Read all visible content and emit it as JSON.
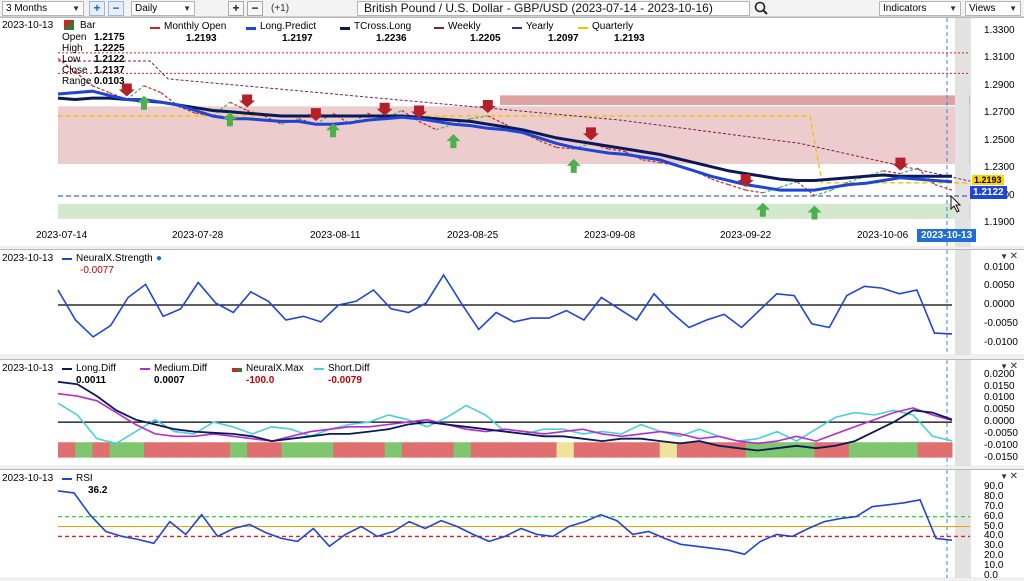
{
  "toolbar": {
    "period": "3 Months",
    "interval": "Daily",
    "offset": "(+1)",
    "title": "British Pound / U.S. Dollar - GBP/USD (2023-07-14 - 2023-10-16)",
    "indicators": "Indicators",
    "views": "Views"
  },
  "icons": {
    "search": "search-icon",
    "zoom_in": "plus-icon",
    "zoom_out": "minus-icon",
    "close": "close-icon",
    "collapse": "chevron-down-icon"
  },
  "colors": {
    "blue": "#1f45d6",
    "navy": "#0b1a57",
    "red_arrow": "#b3202a",
    "green_arrow": "#4caf50",
    "quarterly": "#f2c200",
    "monthly": "#cc2222",
    "weekly": "#7a1f5a"
  },
  "price": {
    "date": "2023-10-13",
    "bar_label": "Bar",
    "ohlc": [
      {
        "label": "Open",
        "value": "1.2175"
      },
      {
        "label": "High",
        "value": "1.2225"
      },
      {
        "label": "Low",
        "value": "1.2122"
      },
      {
        "label": "Close",
        "value": "1.2137"
      },
      {
        "label": "Range",
        "value": "0.0103"
      }
    ],
    "legend": [
      {
        "name": "Monthly Open",
        "value": "1.2193"
      },
      {
        "name": "Long.Predict",
        "value": "1.2197"
      },
      {
        "name": "TCross.Long",
        "value": "1.2236"
      },
      {
        "name": "Weekly",
        "value": "1.2205"
      },
      {
        "name": "Yearly",
        "value": "1.2097"
      },
      {
        "name": "Quarterly",
        "value": "1.2193"
      }
    ],
    "price_tag_top": "1.2193",
    "price_tag": "1.2122",
    "yticks": [
      "1.3300",
      "1.3100",
      "1.2900",
      "1.2700",
      "1.2500",
      "1.2300",
      "1.2100",
      "1.1900"
    ],
    "xticks": [
      "2023-07-14",
      "2023-07-28",
      "2023-08-11",
      "2023-08-25",
      "2023-09-08",
      "2023-09-22",
      "2023-10-06"
    ],
    "current_date": "2023-10-13"
  },
  "strength": {
    "date": "2023-10-13",
    "name": "NeuralX.Strength",
    "value": "-0.0077",
    "yticks": [
      "0.0100",
      "0.0050",
      "0.0000",
      "-0.0050",
      "-0.0100"
    ]
  },
  "diff": {
    "date": "2023-10-13",
    "legend": [
      {
        "name": "Long.Diff",
        "value": "0.0011"
      },
      {
        "name": "Medium.Diff",
        "value": "0.0007"
      },
      {
        "name": "NeuralX.Max",
        "value": "-100.0"
      },
      {
        "name": "Short.Diff",
        "value": "-0.0079"
      }
    ],
    "yticks": [
      "0.0200",
      "0.0150",
      "0.0100",
      "0.0050",
      "0.0000",
      "-0.0050",
      "-0.0100",
      "-0.0150"
    ]
  },
  "rsi": {
    "date": "2023-10-13",
    "name": "RSI",
    "value": "36.2",
    "yticks": [
      "90.0",
      "80.0",
      "70.0",
      "60.0",
      "50.0",
      "40.0",
      "30.0",
      "20.0",
      "10.0",
      "0.0"
    ]
  },
  "chart_data": [
    {
      "type": "line",
      "title": "British Pound / U.S. Dollar - GBP/USD (2023-07-14 - 2023-10-16)",
      "ylim": [
        1.19,
        1.335
      ],
      "x_labels": [
        "2023-07-14",
        "2023-07-28",
        "2023-08-11",
        "2023-08-25",
        "2023-09-08",
        "2023-09-22",
        "2023-10-06"
      ],
      "series": [
        {
          "name": "Long.Predict",
          "values": [
            1.284,
            1.285,
            1.286,
            1.283,
            1.28,
            1.28,
            1.278,
            1.276,
            1.272,
            1.268,
            1.266,
            1.266,
            1.265,
            1.264,
            1.264,
            1.262,
            1.262,
            1.263,
            1.265,
            1.266,
            1.267,
            1.266,
            1.264,
            1.262,
            1.261,
            1.259,
            1.258,
            1.256,
            1.252,
            1.248,
            1.245,
            1.243,
            1.241,
            1.24,
            1.238,
            1.236,
            1.232,
            1.228,
            1.224,
            1.221,
            1.218,
            1.216,
            1.214,
            1.214,
            1.214,
            1.216,
            1.218,
            1.219,
            1.221,
            1.223,
            1.222,
            1.221,
            1.22
          ]
        },
        {
          "name": "TCross.Long",
          "values": [
            1.281,
            1.28,
            1.281,
            1.281,
            1.28,
            1.279,
            1.278,
            1.276,
            1.274,
            1.272,
            1.271,
            1.27,
            1.269,
            1.268,
            1.268,
            1.268,
            1.268,
            1.268,
            1.268,
            1.268,
            1.268,
            1.267,
            1.266,
            1.265,
            1.264,
            1.262,
            1.26,
            1.258,
            1.255,
            1.252,
            1.25,
            1.248,
            1.246,
            1.244,
            1.242,
            1.24,
            1.237,
            1.234,
            1.231,
            1.228,
            1.226,
            1.224,
            1.222,
            1.221,
            1.221,
            1.222,
            1.223,
            1.224,
            1.225,
            1.224,
            1.224,
            1.224,
            1.224
          ]
        },
        {
          "name": "Close",
          "values": [
            1.31,
            1.3,
            1.29,
            1.285,
            1.28,
            1.29,
            1.285,
            1.275,
            1.27,
            1.268,
            1.278,
            1.272,
            1.268,
            1.262,
            1.266,
            1.262,
            1.27,
            1.262,
            1.27,
            1.266,
            1.272,
            1.264,
            1.258,
            1.262,
            1.266,
            1.268,
            1.262,
            1.256,
            1.25,
            1.245,
            1.244,
            1.248,
            1.244,
            1.242,
            1.236,
            1.234,
            1.232,
            1.228,
            1.222,
            1.218,
            1.214,
            1.212,
            1.216,
            1.22,
            1.21,
            1.214,
            1.22,
            1.224,
            1.228,
            1.226,
            1.23,
            1.218,
            1.214
          ]
        }
      ],
      "levels": {
        "Monthly Open": 1.2193,
        "Yearly": 1.2097,
        "Quarterly": 1.2193,
        "Weekly": 1.2205
      }
    },
    {
      "type": "line",
      "series": [
        {
          "name": "NeuralX.Strength",
          "values": [
            0.004,
            -0.004,
            -0.0085,
            -0.0055,
            0.002,
            0.0055,
            -0.003,
            -0.001,
            0.006,
            0.0005,
            -0.002,
            0.0035,
            0.001,
            -0.004,
            -0.003,
            -0.0045,
            0.0,
            0.001,
            0.004,
            -0.001,
            -0.002,
            0.0005,
            0.008,
            0.0005,
            -0.0065,
            -0.002,
            -0.0045,
            -0.0035,
            -0.0035,
            -0.0015,
            -0.004,
            0.002,
            -0.001,
            -0.004,
            0.003,
            -0.002,
            -0.006,
            -0.004,
            -0.0025,
            -0.006,
            -0.0015,
            0.003,
            0.0025,
            -0.005,
            -0.006,
            0.0025,
            0.005,
            0.0045,
            0.003,
            0.004,
            -0.0075,
            -0.0077
          ]
        }
      ],
      "ylim": [
        -0.012,
        0.012
      ]
    },
    {
      "type": "line",
      "series": [
        {
          "name": "Long.Diff",
          "values": [
            0.017,
            0.016,
            0.011,
            0.005,
            0.001,
            -0.001,
            -0.003,
            -0.004,
            -0.0045,
            -0.005,
            -0.006,
            -0.008,
            -0.007,
            -0.006,
            -0.005,
            -0.005,
            -0.004,
            -0.003,
            -0.001,
            0.0,
            -0.001,
            -0.002,
            -0.003,
            -0.004,
            -0.005,
            -0.006,
            -0.006,
            -0.007,
            -0.008,
            -0.007,
            -0.007,
            -0.008,
            -0.009,
            -0.008,
            -0.01,
            -0.011,
            -0.012,
            -0.011,
            -0.01,
            -0.011,
            -0.01,
            -0.008,
            -0.004,
            0.0,
            0.005,
            0.004,
            0.0011
          ]
        },
        {
          "name": "Medium.Diff",
          "values": [
            0.012,
            0.011,
            0.009,
            0.004,
            -0.001,
            -0.005,
            -0.006,
            -0.006,
            -0.005,
            -0.006,
            -0.007,
            -0.008,
            -0.006,
            -0.004,
            -0.003,
            -0.002,
            -0.002,
            -0.001,
            0.0,
            0.001,
            -0.001,
            -0.003,
            -0.004,
            -0.003,
            -0.004,
            -0.005,
            -0.004,
            -0.003,
            -0.005,
            -0.006,
            -0.005,
            -0.004,
            -0.005,
            -0.007,
            -0.006,
            -0.008,
            -0.009,
            -0.008,
            -0.006,
            -0.008,
            -0.005,
            -0.002,
            0.001,
            0.004,
            0.006,
            0.003,
            0.0007
          ]
        },
        {
          "name": "Short.Diff",
          "values": [
            0.008,
            0.003,
            -0.007,
            -0.009,
            -0.004,
            0.001,
            -0.004,
            -0.005,
            0.0,
            -0.002,
            -0.005,
            -0.002,
            -0.003,
            -0.006,
            -0.003,
            -0.001,
            0.0,
            0.003,
            0.001,
            -0.002,
            0.002,
            0.007,
            0.003,
            -0.004,
            -0.005,
            -0.003,
            -0.003,
            -0.005,
            -0.004,
            -0.005,
            -0.001,
            -0.004,
            -0.006,
            -0.003,
            -0.006,
            -0.008,
            -0.007,
            -0.004,
            -0.008,
            -0.003,
            0.002,
            0.004,
            0.003,
            0.005,
            0.003,
            -0.006,
            -0.0079
          ]
        }
      ],
      "ylim": [
        -0.016,
        0.022
      ]
    },
    {
      "type": "line",
      "series": [
        {
          "name": "RSI",
          "values": [
            86,
            84,
            62,
            45,
            40,
            37,
            33,
            55,
            42,
            62,
            40,
            48,
            52,
            44,
            38,
            35,
            48,
            30,
            42,
            50,
            40,
            45,
            55,
            48,
            56,
            50,
            42,
            35,
            40,
            48,
            42,
            40,
            50,
            55,
            62,
            56,
            42,
            45,
            38,
            32,
            30,
            28,
            26,
            22,
            35,
            42,
            40,
            48,
            55,
            58,
            60,
            70,
            72,
            74,
            77,
            38,
            36.2
          ]
        }
      ],
      "levels": [
        60,
        50,
        40
      ],
      "ylim": [
        0,
        95
      ]
    }
  ]
}
